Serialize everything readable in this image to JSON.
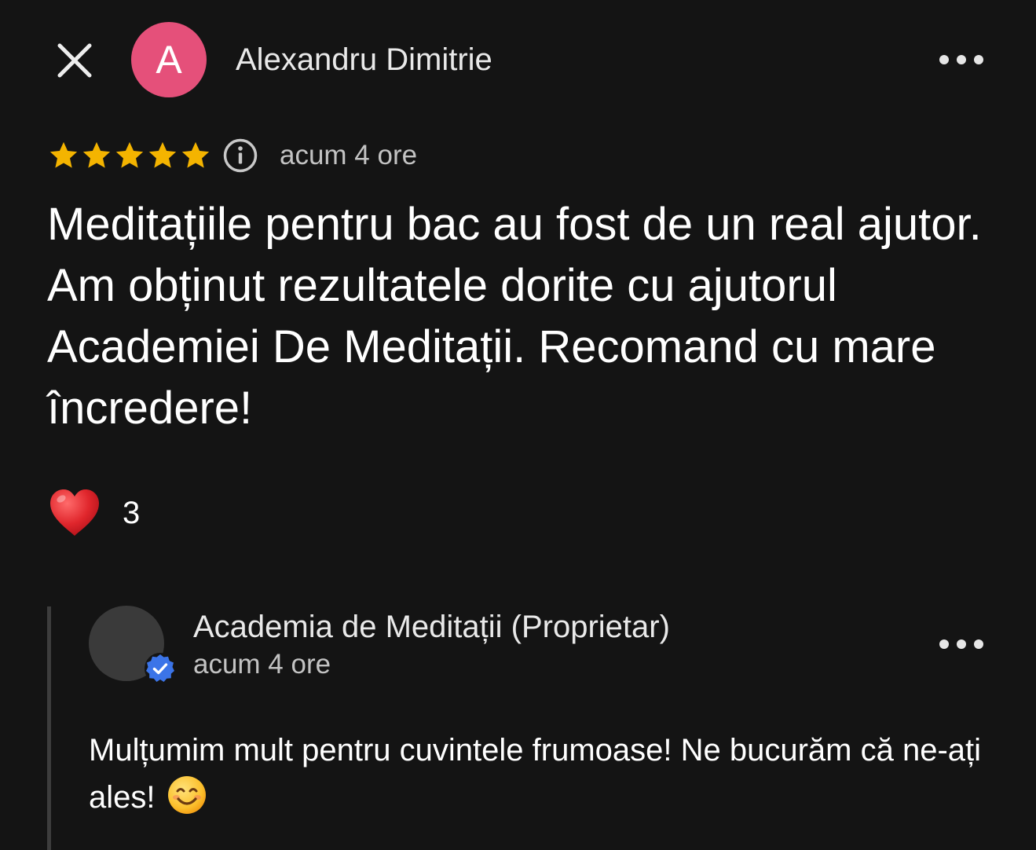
{
  "review": {
    "author_initial": "A",
    "author_name": "Alexandru Dimitrie",
    "rating": 5,
    "max_rating": 5,
    "time": "acum 4 ore",
    "text": "Meditațiile pentru bac au fost de un real ajutor. Am obținut rezultatele dorite cu ajutorul Academiei De Meditații. Recomand cu mare încredere!",
    "reaction_count": "3"
  },
  "reply": {
    "owner_name": "Academia de Meditații (Proprietar)",
    "time": "acum 4 ore",
    "text": "Mulțumim mult pentru cuvintele frumoase! Ne bucurăm că ne-ați ales!"
  },
  "icons": {
    "close": "close-icon",
    "more": "more-options-icon",
    "star": "star-icon",
    "info": "info-icon",
    "heart": "heart-icon",
    "verified": "verified-badge-icon",
    "smile": "smiling-face-emoji"
  },
  "colors": {
    "background": "#141414",
    "avatar": "#e5507a",
    "star": "#f4b400",
    "heart": "#e0262c",
    "verified": "#3b74e8",
    "secondary_text": "#c3c3c3"
  }
}
